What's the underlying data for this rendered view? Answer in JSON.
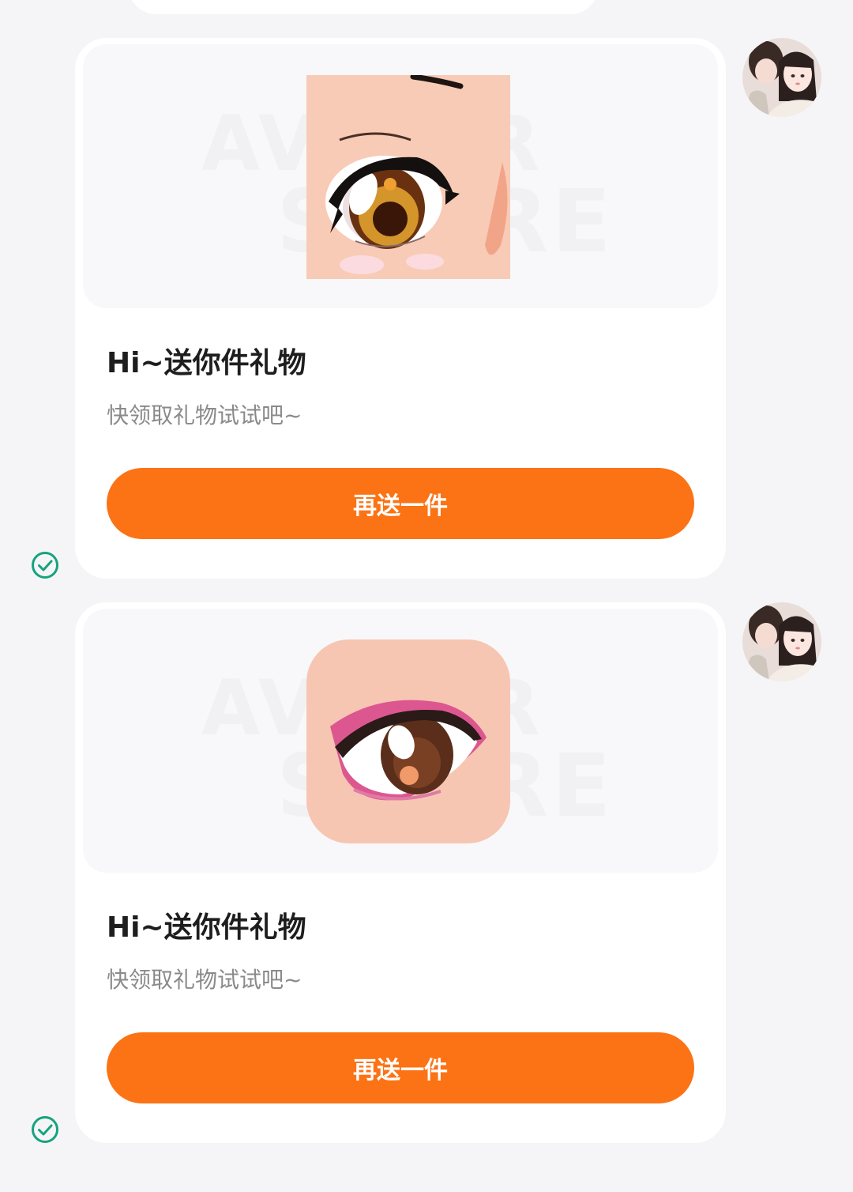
{
  "messages": [
    {
      "title": "Hi~送你件礼物",
      "subtitle": "快领取礼物试试吧~",
      "button_label": "再送一件",
      "gift_icon": "anime-eye-icon",
      "status_icon": "check-circle-icon"
    },
    {
      "title": "Hi~送你件礼物",
      "subtitle": "快领取礼物试试吧~",
      "button_label": "再送一件",
      "gift_icon": "pink-eye-makeup-icon",
      "status_icon": "check-circle-icon"
    }
  ],
  "watermark": {
    "line1": "AVATAR",
    "line2": "STORE"
  },
  "colors": {
    "accent": "#fb7314",
    "status": "#16a37f",
    "background": "#f5f5f7"
  }
}
